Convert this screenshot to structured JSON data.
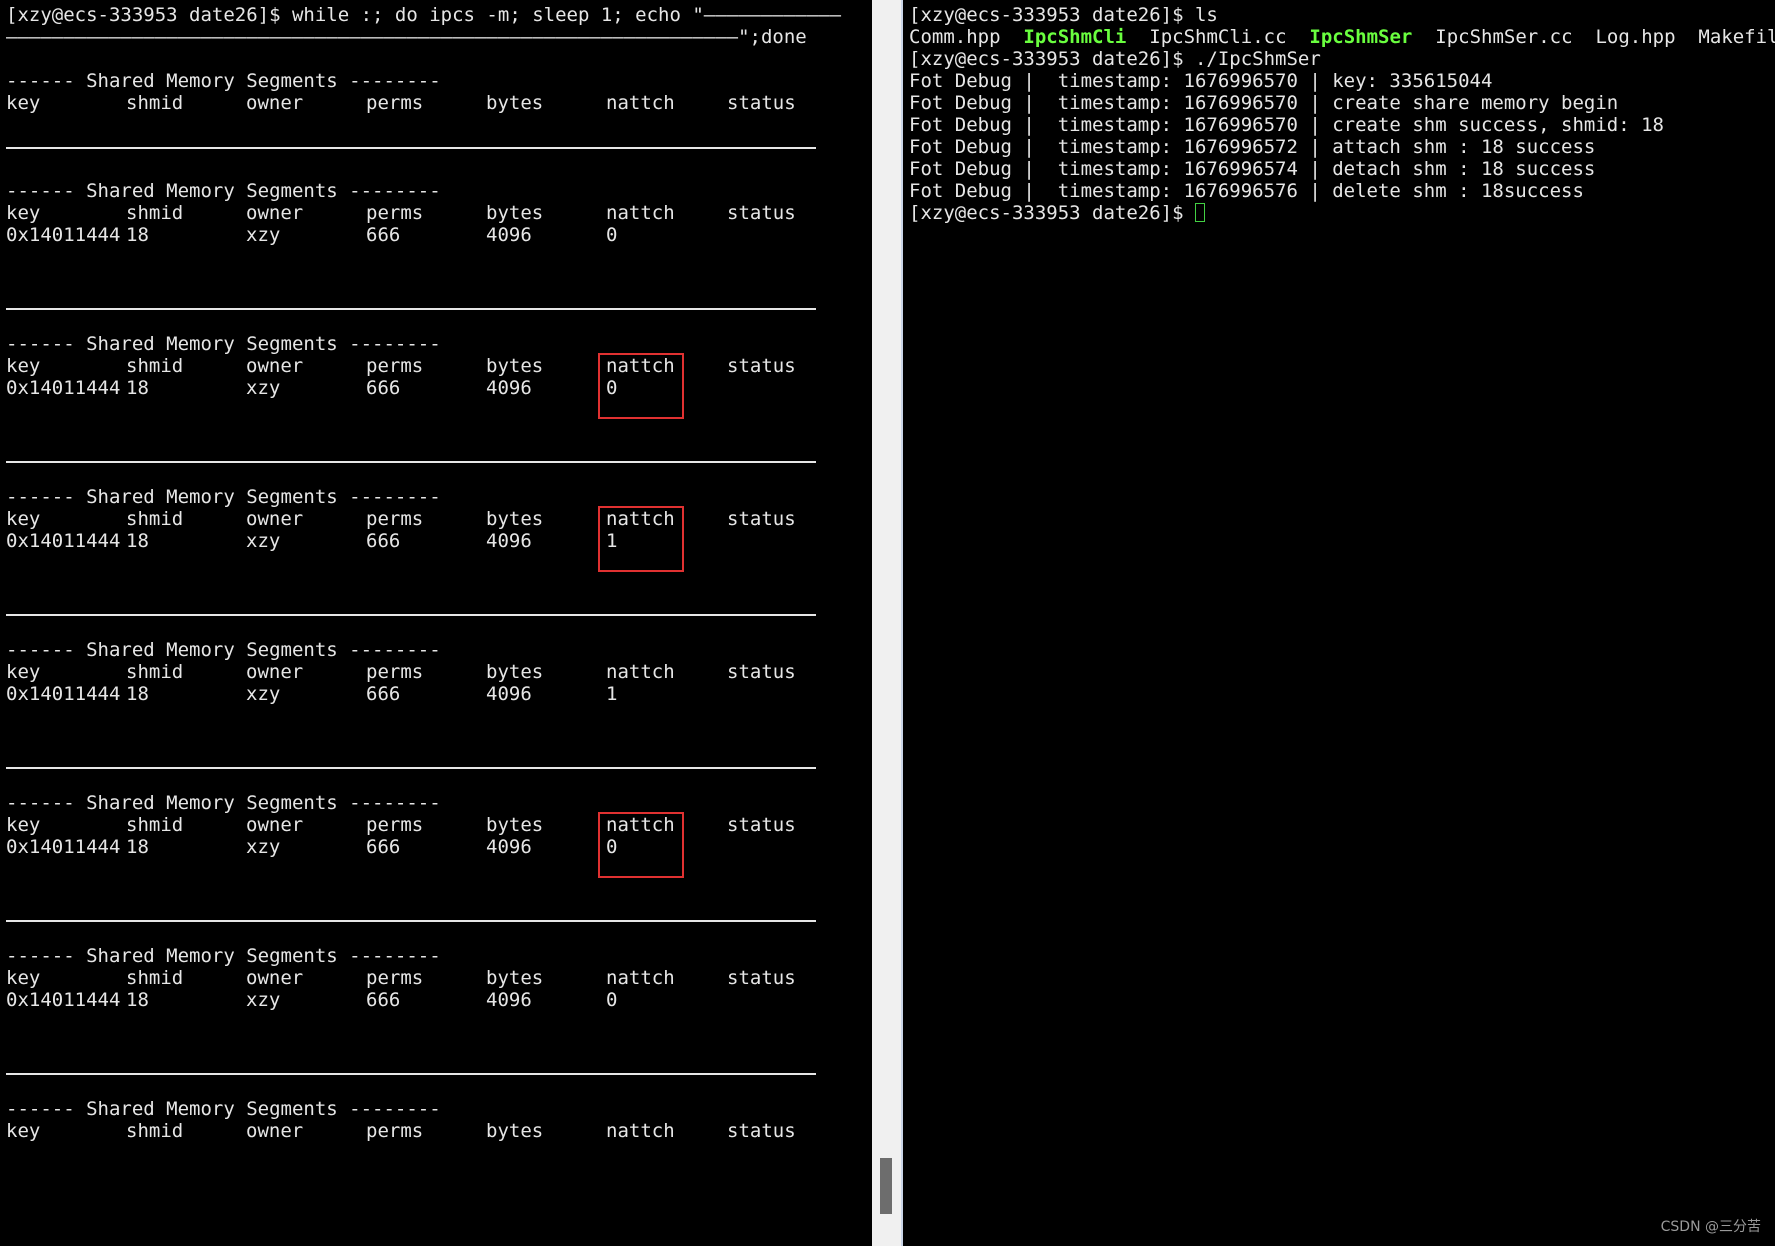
{
  "left_terminal": {
    "command_line1": "[xzy@ecs-333953 date26]$ while :; do ipcs -m; sleep 1; echo \"————————————",
    "command_line2": "————————————————————————————————————————————————————————————————\";done",
    "segment_title": "------ Shared Memory Segments --------",
    "columns": [
      "key",
      "shmid",
      "owner",
      "perms",
      "bytes",
      "nattch",
      "status"
    ],
    "blocks": [
      {
        "row": null
      },
      {
        "row": [
          "0x14011444",
          "18",
          "xzy",
          "666",
          "4096",
          "0",
          ""
        ]
      },
      {
        "row": [
          "0x14011444",
          "18",
          "xzy",
          "666",
          "4096",
          "0",
          ""
        ]
      },
      {
        "row": [
          "0x14011444",
          "18",
          "xzy",
          "666",
          "4096",
          "1",
          ""
        ]
      },
      {
        "row": [
          "0x14011444",
          "18",
          "xzy",
          "666",
          "4096",
          "1",
          ""
        ]
      },
      {
        "row": [
          "0x14011444",
          "18",
          "xzy",
          "666",
          "4096",
          "0",
          ""
        ]
      },
      {
        "row": [
          "0x14011444",
          "18",
          "xzy",
          "666",
          "4096",
          "0",
          ""
        ]
      },
      {
        "row": null
      }
    ],
    "trailing_title": "------ Shared Memory Segments --------"
  },
  "right_terminal": {
    "lines": [
      "[xzy@ecs-333953 date26]$ ls",
      "",
      "[xzy@ecs-333953 date26]$ ./IpcShmSer",
      "Fot Debug |  timestamp: 1676996570 | key: 335615044",
      "Fot Debug |  timestamp: 1676996570 | create share memory begin",
      "Fot Debug |  timestamp: 1676996570 | create shm success, shmid: 18",
      "Fot Debug |  timestamp: 1676996572 | attach shm : 18 success",
      "Fot Debug |  timestamp: 1676996574 | detach shm : 18 success",
      "Fot Debug |  timestamp: 1676996576 | delete shm : 18success",
      "[xzy@ecs-333953 date26]$ "
    ],
    "ls_files": [
      {
        "name": "Comm.hpp",
        "exec": false
      },
      {
        "name": "IpcShmCli",
        "exec": true
      },
      {
        "name": "IpcShmCli.cc",
        "exec": false
      },
      {
        "name": "IpcShmSer",
        "exec": true
      },
      {
        "name": "IpcShmSer.cc",
        "exec": false
      },
      {
        "name": "Log.hpp",
        "exec": false
      },
      {
        "name": "Makefile",
        "exec": false
      }
    ]
  },
  "watermark": "CSDN @三分苦",
  "colors": {
    "terminal_bg": "#000000",
    "text": "#e6e6e6",
    "exec_file": "#6aff3f",
    "highlight_box": "#e03131"
  }
}
